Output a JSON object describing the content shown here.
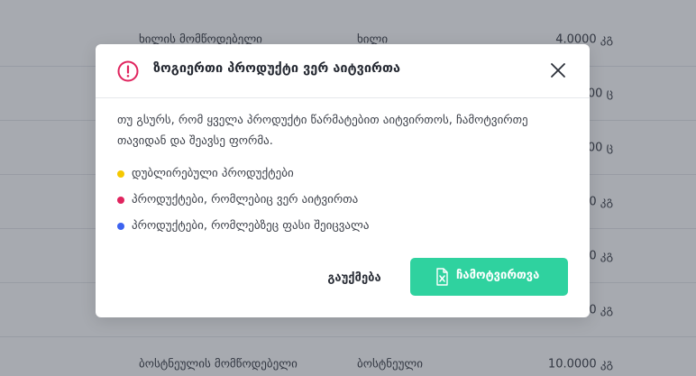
{
  "table": {
    "rows": [
      {
        "name": "ხილის მომწოდებელი",
        "category": "ხილი",
        "quantity": "4.0000 კგ"
      },
      {
        "name": "",
        "category": "",
        "quantity": "0.0000 ც"
      },
      {
        "name": "",
        "category": "",
        "quantity": "0.0000 ც"
      },
      {
        "name": "",
        "category": "",
        "quantity": "0.0000 კგ"
      },
      {
        "name": "",
        "category": "",
        "quantity": "0.0000 კგ"
      },
      {
        "name": "",
        "category": "",
        "quantity": "0.0000 კგ"
      },
      {
        "name": "ბოსტნეულის მომწოდებელი",
        "category": "ბოსტნეული",
        "quantity": "10.0000 კგ"
      }
    ]
  },
  "modal": {
    "title": "ზოგიერთი პროდუქტი ვერ აიტვირთა",
    "description": "თუ გსურს, რომ ყველა პროდუქტი წარმატებით აიტვირთოს, ჩამოტვირთე თავიდან და შეავსე ფორმა.",
    "legend": [
      {
        "label": "დუბლირებული პროდუქტები",
        "color": "#f5c800"
      },
      {
        "label": "პროდუქტები, რომლებიც ვერ აიტვირთა",
        "color": "#e0245e"
      },
      {
        "label": "პროდუქტები, რომლებზეც ფასი შეიცვალა",
        "color": "#3d63f0"
      }
    ],
    "cancel_label": "გაუქმება",
    "confirm_label": "ჩამოტვირთვა",
    "warn_icon_color": "#e0245e",
    "accent_color": "#2fd29f"
  }
}
